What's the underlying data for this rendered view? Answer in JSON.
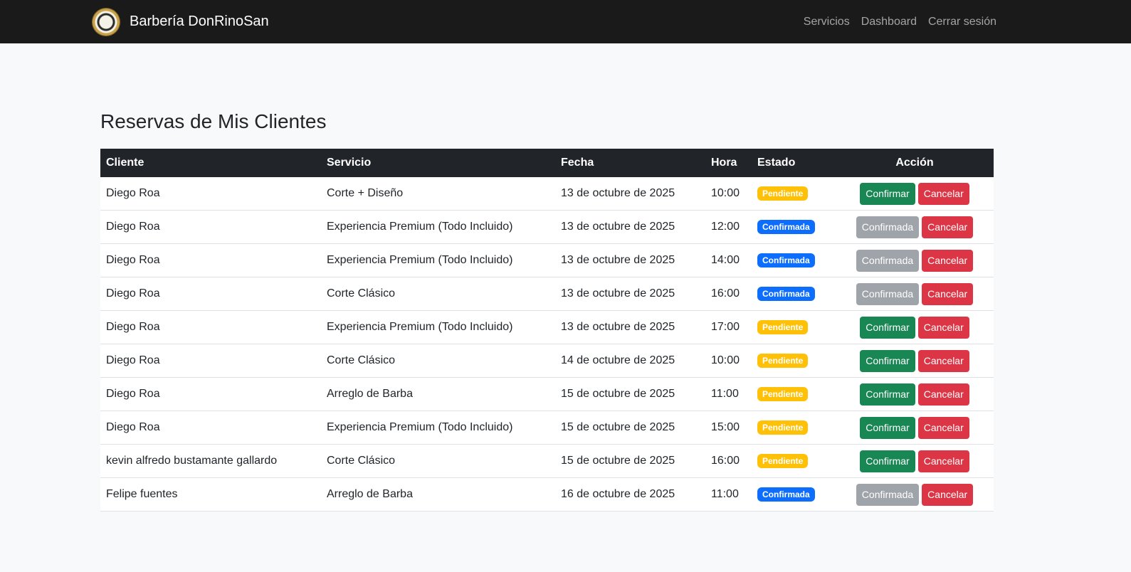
{
  "colors": {
    "navbar": "#1a1a1a",
    "header": "#212529",
    "success": "#198754",
    "danger": "#dc3545",
    "warning": "#ffc107",
    "primary": "#0d6efd",
    "secondary": "#6c757d"
  },
  "navbar": {
    "logo_icon": "barbershop-logo",
    "brand": "Barbería DonRinoSan",
    "links": [
      "Servicios",
      "Dashboard",
      "Cerrar sesión"
    ]
  },
  "page": {
    "title": "Reservas de Mis Clientes"
  },
  "table": {
    "headers": [
      "Cliente",
      "Servicio",
      "Fecha",
      "Hora",
      "Estado",
      "Acción"
    ],
    "rows": [
      {
        "cliente": "Diego Roa",
        "servicio": "Corte + Diseño",
        "fecha": "13 de octubre de 2025",
        "hora": "10:00",
        "estado": "Pendiente",
        "confirm_label": "Confirmar",
        "cancel_label": "Cancelar"
      },
      {
        "cliente": "Diego Roa",
        "servicio": "Experiencia Premium (Todo Incluido)",
        "fecha": "13 de octubre de 2025",
        "hora": "12:00",
        "estado": "Confirmada",
        "confirm_label": "Confirmada",
        "cancel_label": "Cancelar"
      },
      {
        "cliente": "Diego Roa",
        "servicio": "Experiencia Premium (Todo Incluido)",
        "fecha": "13 de octubre de 2025",
        "hora": "14:00",
        "estado": "Confirmada",
        "confirm_label": "Confirmada",
        "cancel_label": "Cancelar"
      },
      {
        "cliente": "Diego Roa",
        "servicio": "Corte Clásico",
        "fecha": "13 de octubre de 2025",
        "hora": "16:00",
        "estado": "Confirmada",
        "confirm_label": "Confirmada",
        "cancel_label": "Cancelar"
      },
      {
        "cliente": "Diego Roa",
        "servicio": "Experiencia Premium (Todo Incluido)",
        "fecha": "13 de octubre de 2025",
        "hora": "17:00",
        "estado": "Pendiente",
        "confirm_label": "Confirmar",
        "cancel_label": "Cancelar"
      },
      {
        "cliente": "Diego Roa",
        "servicio": "Corte Clásico",
        "fecha": "14 de octubre de 2025",
        "hora": "10:00",
        "estado": "Pendiente",
        "confirm_label": "Confirmar",
        "cancel_label": "Cancelar"
      },
      {
        "cliente": "Diego Roa",
        "servicio": "Arreglo de Barba",
        "fecha": "15 de octubre de 2025",
        "hora": "11:00",
        "estado": "Pendiente",
        "confirm_label": "Confirmar",
        "cancel_label": "Cancelar"
      },
      {
        "cliente": "Diego Roa",
        "servicio": "Experiencia Premium (Todo Incluido)",
        "fecha": "15 de octubre de 2025",
        "hora": "15:00",
        "estado": "Pendiente",
        "confirm_label": "Confirmar",
        "cancel_label": "Cancelar"
      },
      {
        "cliente": "kevin alfredo bustamante gallardo",
        "servicio": "Corte Clásico",
        "fecha": "15 de octubre de 2025",
        "hora": "16:00",
        "estado": "Pendiente",
        "confirm_label": "Confirmar",
        "cancel_label": "Cancelar"
      },
      {
        "cliente": "Felipe fuentes",
        "servicio": "Arreglo de Barba",
        "fecha": "16 de octubre de 2025",
        "hora": "11:00",
        "estado": "Confirmada",
        "confirm_label": "Confirmada",
        "cancel_label": "Cancelar"
      }
    ]
  }
}
